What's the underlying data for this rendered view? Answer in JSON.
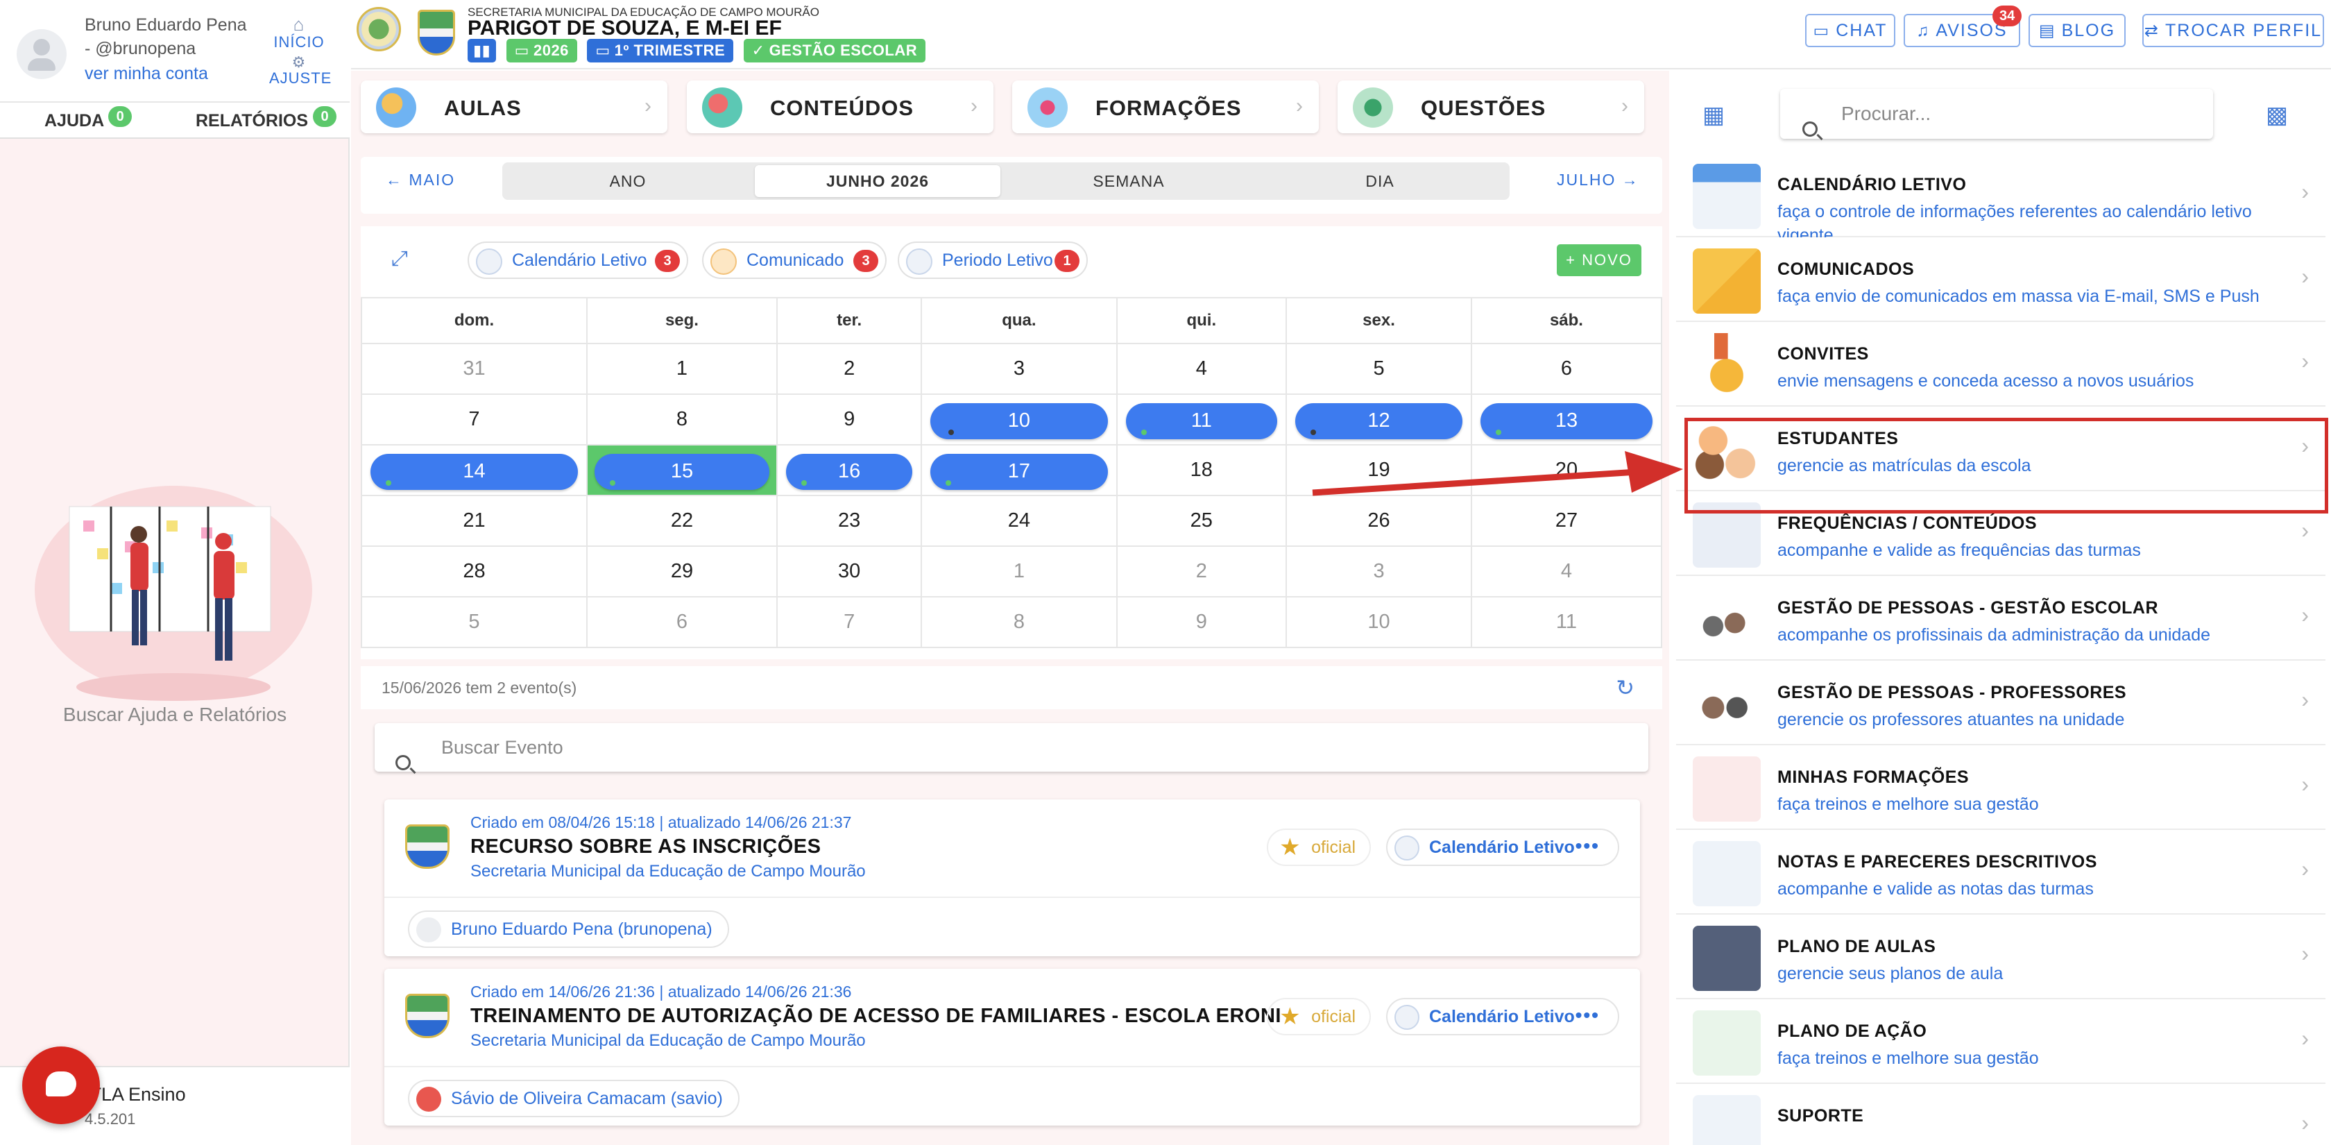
{
  "user": {
    "name_line1": "Bruno Eduardo Pena",
    "name_line2": "- @brunopena",
    "account_link": "ver minha conta"
  },
  "nav": {
    "home_label": "INÍCIO",
    "settings_label": "AJUSTE"
  },
  "helpbar": {
    "help_label": "AJUDA",
    "help_count": "0",
    "reports_label": "RELATÓRIOS",
    "reports_count": "0"
  },
  "sidebar": {
    "help_text": "Buscar Ajuda e Relatórios",
    "version_title": "ITLA Ensino",
    "version": "4.5.201"
  },
  "header": {
    "secretaria": "SECRETARIA MUNICIPAL DA EDUCAÇÃO DE CAMPO MOURÃO",
    "school": "PARIGOT DE SOUZA, E M-EI EF",
    "year_chip": "2026",
    "term_chip": "1º TRIMESTRE",
    "mgmt_chip": "GESTÃO ESCOLAR",
    "chat_label": "CHAT",
    "avisos_label": "AVISOS",
    "avisos_count": "34",
    "blog_label": "BLOG",
    "profile_label": "TROCAR PERFIL"
  },
  "modules": [
    {
      "label": "AULAS"
    },
    {
      "label": "CONTEÚDOS"
    },
    {
      "label": "FORMAÇÕES"
    },
    {
      "label": "QUESTÕES"
    }
  ],
  "calendar_nav": {
    "prev": "MAIO",
    "next": "JULHO",
    "views": [
      "ANO",
      "JUNHO 2026",
      "SEMANA",
      "DIA"
    ],
    "active_view": "JUNHO 2026"
  },
  "filters": [
    {
      "label": "Calendário Letivo",
      "count": "3"
    },
    {
      "label": "Comunicado",
      "count": "3"
    },
    {
      "label": "Periodo Letivo",
      "count": "1"
    }
  ],
  "new_button": "NOVO",
  "weekdays": [
    "dom.",
    "seg.",
    "ter.",
    "qua.",
    "qui.",
    "sex.",
    "sáb."
  ],
  "weeks": [
    [
      "31",
      "1",
      "2",
      "3",
      "4",
      "5",
      "6"
    ],
    [
      "7",
      "8",
      "9",
      "10",
      "11",
      "12",
      "13"
    ],
    [
      "14",
      "15",
      "16",
      "17",
      "18",
      "19",
      "20"
    ],
    [
      "21",
      "22",
      "23",
      "24",
      "25",
      "26",
      "27"
    ],
    [
      "28",
      "29",
      "30",
      "1",
      "2",
      "3",
      "4"
    ],
    [
      "5",
      "6",
      "7",
      "8",
      "9",
      "10",
      "11"
    ]
  ],
  "event_summary": "15/06/2026 tem 2 evento(s)",
  "event_search_placeholder": "Buscar Evento",
  "events": [
    {
      "meta": "Criado em 08/04/26 15:18 | atualizado 14/06/26 21:37",
      "title": "RECURSO SOBRE AS INSCRIÇÕES",
      "org": "Secretaria Municipal da Educação de Campo Mourão",
      "official": "oficial",
      "category": "Calendário Letivo",
      "owner": "Bruno Eduardo Pena (brunopena)"
    },
    {
      "meta": "Criado em 14/06/26 21:36 | atualizado 14/06/26 21:36",
      "title": "TREINAMENTO DE AUTORIZAÇÃO DE ACESSO DE FAMILIARES - ESCOLA ERONI",
      "org": "Secretaria Municipal da Educação de Campo Mourão",
      "official": "oficial",
      "category": "Calendário Letivo",
      "owner": "Sávio de Oliveira Camacam (savio)"
    }
  ],
  "right_panel": {
    "search_placeholder": "Procurar...",
    "items": [
      {
        "title": "CALENDÁRIO LETIVO",
        "subtitle": "faça o controle de informações referentes ao calendário letivo vigente"
      },
      {
        "title": "COMUNICADOS",
        "subtitle": "faça envio de comunicados em massa via E-mail, SMS e Push"
      },
      {
        "title": "CONVITES",
        "subtitle": "envie mensagens e conceda acesso a novos usuários"
      },
      {
        "title": "ESTUDANTES",
        "subtitle": "gerencie as matrículas da escola"
      },
      {
        "title": "FREQUÊNCIAS / CONTEÚDOS",
        "subtitle": "acompanhe e valide as frequências das turmas"
      },
      {
        "title": "GESTÃO DE PESSOAS - GESTÃO ESCOLAR",
        "subtitle": "acompanhe os profissinais da administração da unidade"
      },
      {
        "title": "GESTÃO DE PESSOAS - PROFESSORES",
        "subtitle": "gerencie os professores atuantes na unidade"
      },
      {
        "title": "MINHAS FORMAÇÕES",
        "subtitle": "faça treinos e melhore sua gestão"
      },
      {
        "title": "NOTAS E PARECERES DESCRITIVOS",
        "subtitle": "acompanhe e valide as notas das turmas"
      },
      {
        "title": "PLANO DE AULAS",
        "subtitle": "gerencie seus planos de aula"
      },
      {
        "title": "PLANO DE AÇÃO",
        "subtitle": "faça treinos e melhore sua gestão"
      },
      {
        "title": "SUPORTE",
        "subtitle": ""
      }
    ]
  },
  "colors": {
    "accent": "#2f6fd8",
    "event_pill": "#3d7bef",
    "today": "#5cc86b",
    "badge": "#e33b3b",
    "highlight": "#d22f2a"
  }
}
